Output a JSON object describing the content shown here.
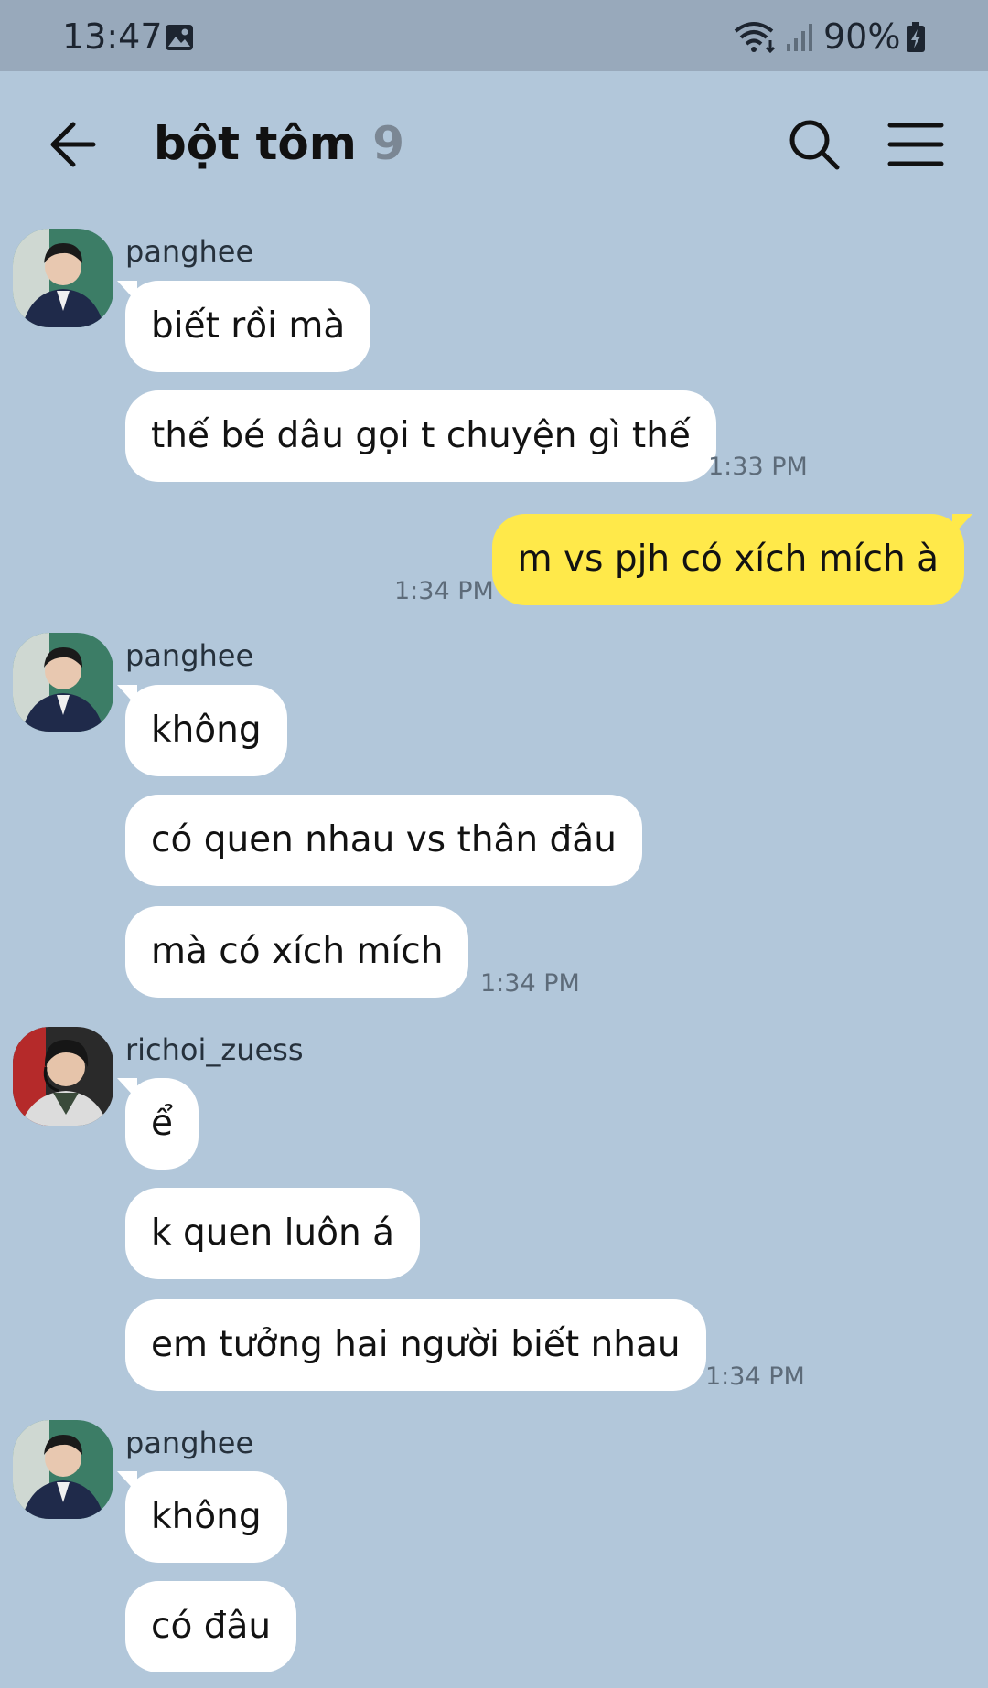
{
  "status_bar": {
    "time": "13:47",
    "battery": "90%",
    "icons": [
      "photo-icon",
      "wifi-icon",
      "signal-icon",
      "battery-charging-icon"
    ]
  },
  "header": {
    "title": "bột tôm",
    "member_count": "9",
    "icons": [
      "back-arrow-icon",
      "search-icon",
      "menu-icon"
    ]
  },
  "messages": {
    "g1": {
      "sender": "panghee",
      "m1": "biết rồi mà",
      "m2": "thế bé dâu gọi t chuyện gì thế",
      "time": "1:33 PM"
    },
    "mine": {
      "m1": "m vs pjh có xích mích à",
      "time": "1:34 PM"
    },
    "g2": {
      "sender": "panghee",
      "m1": "không",
      "m2": "có quen nhau vs thân đâu",
      "m3": "mà có xích mích",
      "time": "1:34 PM"
    },
    "g3": {
      "sender": "richoi_zuess",
      "m1": "ể",
      "m2": "k quen luôn á",
      "m3": "em tưởng hai người biết nhau",
      "time": "1:34 PM"
    },
    "g4": {
      "sender": "panghee",
      "m1": "không",
      "m2": "có đâu"
    }
  },
  "colors": {
    "background": "#b2c7da",
    "status_bar": "#98a9bb",
    "bubble_incoming": "#ffffff",
    "bubble_outgoing": "#ffe94a"
  }
}
